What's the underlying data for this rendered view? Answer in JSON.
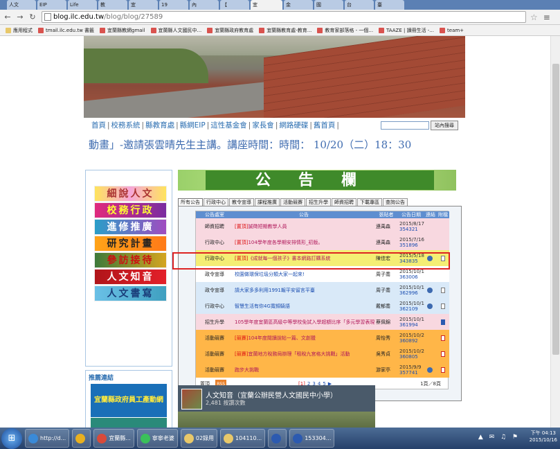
{
  "browser": {
    "tabs": [
      "人文",
      "EIP",
      "Life",
      "教",
      "宜",
      "19",
      "內",
      "【",
      "宜",
      "金",
      "國",
      "台",
      "臺"
    ],
    "url_host": "blog.ilc.edu.tw",
    "url_path": "/blog/blog/27589",
    "bookmarks": [
      "應用程式",
      "tmail.ilc.edu.tw 書籤",
      "宜蘭縣教網gmail",
      "宜蘭縣人文國民中...",
      "宜蘭縣政府教育處",
      "宜蘭縣教育處-教育...",
      "教育家部落格 - 一個...",
      "TAAZE | 讀冊生活 -...",
      "team+"
    ]
  },
  "site_nav": {
    "links": [
      "首頁",
      "校務系統",
      "縣教育處",
      "縣網EIP",
      "這性基金會",
      "家長會",
      "網路硬碟",
      "舊首頁"
    ],
    "search_button": "站內搜尋"
  },
  "marquee": "動畫」-邀請張雲晴先生主講。講座時間：時間： 10/20（二）18：30",
  "sidebar": {
    "menu": [
      "細說人文",
      "校務行政",
      "進修推廣",
      "研究計畫",
      "參訪接待",
      "人文知音",
      "人文書寫"
    ],
    "links_title": "推薦連結",
    "links_banner": "宜蘭縣政府員工產動網"
  },
  "announcements": {
    "header": "公告欄",
    "tabs": [
      "所有公告",
      "行政中心",
      "教令宣導",
      "課程推廣",
      "活動競賽",
      "招生升學",
      "師資招聘",
      "下載專區",
      "查詢公告"
    ],
    "columns": [
      "公告處室",
      "公告",
      "張貼者",
      "公告日期",
      "連結",
      "附檔"
    ],
    "rows": [
      {
        "office": "師資招聘",
        "tag": "[置頂]",
        "title": "誠徵短期教學人員",
        "poster": "連禹森",
        "date": "2015/8/17",
        "id": "354321",
        "style": "r-pink",
        "link": "",
        "file": ""
      },
      {
        "office": "行政中心",
        "tag": "[置頂]",
        "title": "104學年度各學期安排情形_初版。",
        "poster": "連禹森",
        "date": "2015/7/16",
        "id": "351896",
        "style": "r-pink",
        "link": "",
        "file": ""
      },
      {
        "office": "行政中心",
        "tag": "[置頂]",
        "title": "《成就每一個孩子》書本網路訂購系統",
        "poster": "陳佳宏",
        "date": "2015/5/18",
        "id": "343835",
        "style": "r-yellow",
        "link": "globe",
        "file": "doc"
      },
      {
        "office": "政令宣導",
        "tag": "",
        "title": "校園做環保垃圾分類大家一起來!",
        "poster": "周子喬",
        "date": "2015/10/16",
        "id": "363006",
        "style": "r-white",
        "link": "",
        "file": ""
      },
      {
        "office": "政令宣導",
        "tag": "",
        "title": "請大家多多利用1991報平安留言平臺",
        "poster": "周子喬",
        "date": "2015/10/16",
        "id": "362996",
        "style": "r-blue",
        "link": "globe",
        "file": "doc"
      },
      {
        "office": "行政中心",
        "tag": "",
        "title": "智慧生活有你4G寬頻騎語",
        "poster": "戴郁喬",
        "date": "2015/10/12",
        "id": "362109",
        "style": "r-blue",
        "link": "globe",
        "file": "doc"
      },
      {
        "office": "招生升學",
        "tag": "",
        "title": "105學年度宜蘭區高級中等學校免試入學超額比序「多元學習表現--服務表現、體適能表現、競賽表現」採計 相關說明",
        "poster": "蔡佩錦",
        "date": "2015/10/12",
        "id": "361994",
        "style": "r-pink",
        "link": "",
        "file": "word"
      },
      {
        "office": "活動競賽",
        "tag": "[競賽]",
        "title": "104年度閱讀說帖一篇、文創獵",
        "poster": "周怡秀",
        "date": "2015/10/2",
        "id": "360892",
        "style": "r-orange",
        "link": "",
        "file": "pdf"
      },
      {
        "office": "活動競賽",
        "tag": "[競賽]",
        "title": "宜蘭地方稅務局辦理「租稅九宮格大挑戰」活動",
        "poster": "吳秀貞",
        "date": "2015/10/2",
        "id": "360805",
        "style": "r-orange",
        "link": "",
        "file": "pdf"
      },
      {
        "office": "活動競賽",
        "tag": "",
        "title": "跑步大挑戰",
        "poster": "游家亭",
        "date": "2015/9/9",
        "id": "357741",
        "style": "r-orange",
        "link": "globe",
        "file": "pdf"
      }
    ],
    "footer": {
      "pin_label": "置頂",
      "rss_label": "RSS",
      "pages": [
        "[1]",
        "2",
        "3",
        "4",
        "5"
      ],
      "count": "1頁／8頁"
    }
  },
  "facebook": {
    "name": "人文知音（宜蘭公辦民營人文國民中小學）",
    "likes": "2,481 按讚次數"
  },
  "taskbar": {
    "items": [
      "http://d...",
      "",
      "宜蘭縣...",
      "寧寧老婆",
      "02錄用",
      "104110...",
      "",
      "153304..."
    ],
    "time": "下午 04:13",
    "date": "2015/10/16"
  }
}
